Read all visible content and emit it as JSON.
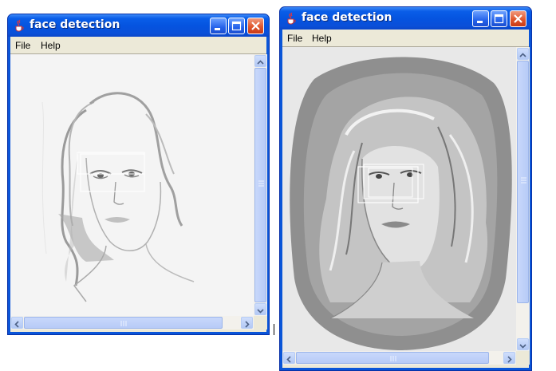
{
  "windows": [
    {
      "title": "face detection",
      "menu": {
        "file": "File",
        "help": "Help"
      }
    },
    {
      "title": "face detection",
      "menu": {
        "file": "File",
        "help": "Help"
      }
    }
  ],
  "colors": {
    "titlebar": "#0554e0",
    "frame": "#0a55d8",
    "menu_bg": "#ece9d8",
    "close": "#e0572e"
  },
  "icons": [
    "java-cup-icon",
    "minimize-icon",
    "maximize-icon",
    "close-icon",
    "scroll-up-icon",
    "scroll-down-icon",
    "scroll-left-icon",
    "scroll-right-icon"
  ]
}
